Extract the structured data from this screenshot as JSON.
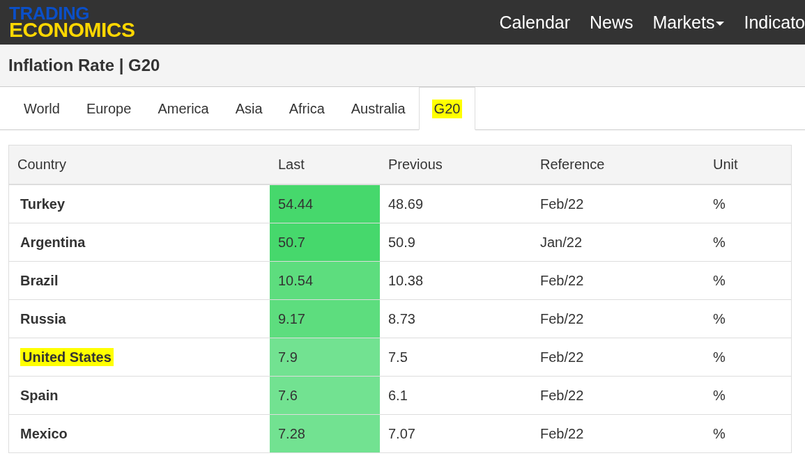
{
  "logo": {
    "top": "TRADING",
    "bottom": "ECONOMICS"
  },
  "nav": [
    {
      "label": "Calendar",
      "dropdown": false
    },
    {
      "label": "News",
      "dropdown": false
    },
    {
      "label": "Markets",
      "dropdown": true
    },
    {
      "label": "Indicato",
      "dropdown": false
    }
  ],
  "page_title": "Inflation Rate | G20",
  "tabs": [
    {
      "label": "World",
      "selected": false,
      "highlighted": false
    },
    {
      "label": "Europe",
      "selected": false,
      "highlighted": false
    },
    {
      "label": "America",
      "selected": false,
      "highlighted": false
    },
    {
      "label": "Asia",
      "selected": false,
      "highlighted": false
    },
    {
      "label": "Africa",
      "selected": false,
      "highlighted": false
    },
    {
      "label": "Australia",
      "selected": false,
      "highlighted": false
    },
    {
      "label": "G20",
      "selected": true,
      "highlighted": true
    }
  ],
  "table": {
    "columns": [
      "Country",
      "Last",
      "Previous",
      "Reference",
      "Unit"
    ],
    "rows": [
      {
        "country": "Turkey",
        "highlighted": false,
        "last": "54.44",
        "color": "#46d86c",
        "previous": "48.69",
        "reference": "Feb/22",
        "unit": "%"
      },
      {
        "country": "Argentina",
        "highlighted": false,
        "last": "50.7",
        "color": "#46d86c",
        "previous": "50.9",
        "reference": "Jan/22",
        "unit": "%"
      },
      {
        "country": "Brazil",
        "highlighted": false,
        "last": "10.54",
        "color": "#5ddd7e",
        "previous": "10.38",
        "reference": "Feb/22",
        "unit": "%"
      },
      {
        "country": "Russia",
        "highlighted": false,
        "last": "9.17",
        "color": "#5ddd7e",
        "previous": "8.73",
        "reference": "Feb/22",
        "unit": "%"
      },
      {
        "country": "United States",
        "highlighted": true,
        "last": "7.9",
        "color": "#72e291",
        "previous": "7.5",
        "reference": "Feb/22",
        "unit": "%"
      },
      {
        "country": "Spain",
        "highlighted": false,
        "last": "7.6",
        "color": "#72e291",
        "previous": "6.1",
        "reference": "Feb/22",
        "unit": "%"
      },
      {
        "country": "Mexico",
        "highlighted": false,
        "last": "7.28",
        "color": "#72e291",
        "previous": "7.07",
        "reference": "Feb/22",
        "unit": "%"
      }
    ]
  }
}
